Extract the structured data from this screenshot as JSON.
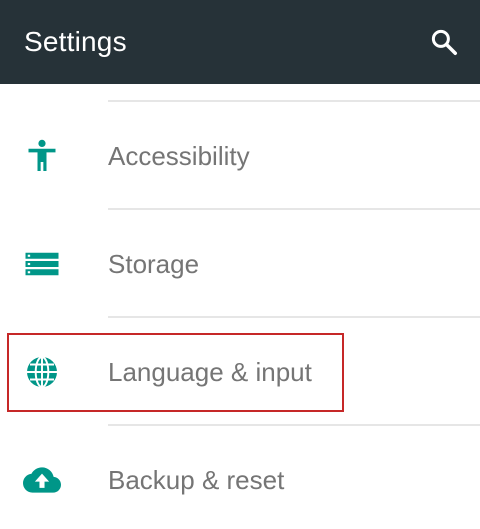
{
  "appbar": {
    "title": "Settings",
    "background": "#263238",
    "search_icon": "search-icon"
  },
  "accent_color": "#009688",
  "highlight_color": "#c62828",
  "settings_items": [
    {
      "label": "Accessibility",
      "icon": "accessibility-icon"
    },
    {
      "label": "Storage",
      "icon": "storage-icon"
    },
    {
      "label": "Language & input",
      "icon": "globe-icon",
      "highlighted": true
    },
    {
      "label": "Backup & reset",
      "icon": "cloud-upload-icon"
    }
  ]
}
